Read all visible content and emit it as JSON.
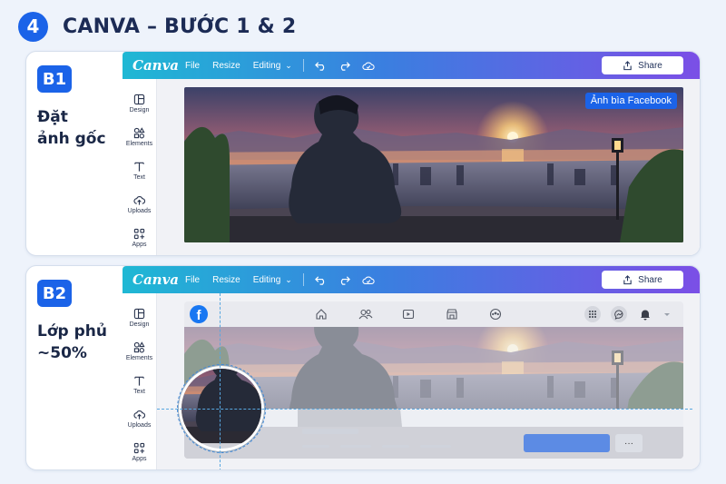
{
  "header": {
    "step_number": "4",
    "title": "CANVA – BƯỚC 1 & 2"
  },
  "steps": [
    {
      "badge": "B1",
      "desc_lines": [
        "Đặt",
        "ảnh gốc"
      ]
    },
    {
      "badge": "B2",
      "desc_lines": [
        "Lớp phủ",
        "~50%"
      ]
    }
  ],
  "editor": {
    "logo": "Canva",
    "menu": {
      "file": "File",
      "resize": "Resize",
      "editing": "Editing"
    },
    "share_label": "Share",
    "sidebar": [
      {
        "label": "Design",
        "icon": "design-icon"
      },
      {
        "label": "Elements",
        "icon": "elements-icon"
      },
      {
        "label": "Text",
        "icon": "text-icon"
      },
      {
        "label": "Uploads",
        "icon": "uploads-icon"
      },
      {
        "label": "Apps",
        "icon": "apps-icon"
      }
    ]
  },
  "cover_tag": "Ảnh bìa Facebook",
  "facebook": {
    "logo": "f",
    "more": "···"
  },
  "colors": {
    "accent": "#1b63e8",
    "topbar_start": "#1fb8d4",
    "topbar_end": "#7b4fe6",
    "facebook_blue": "#1877f2"
  }
}
